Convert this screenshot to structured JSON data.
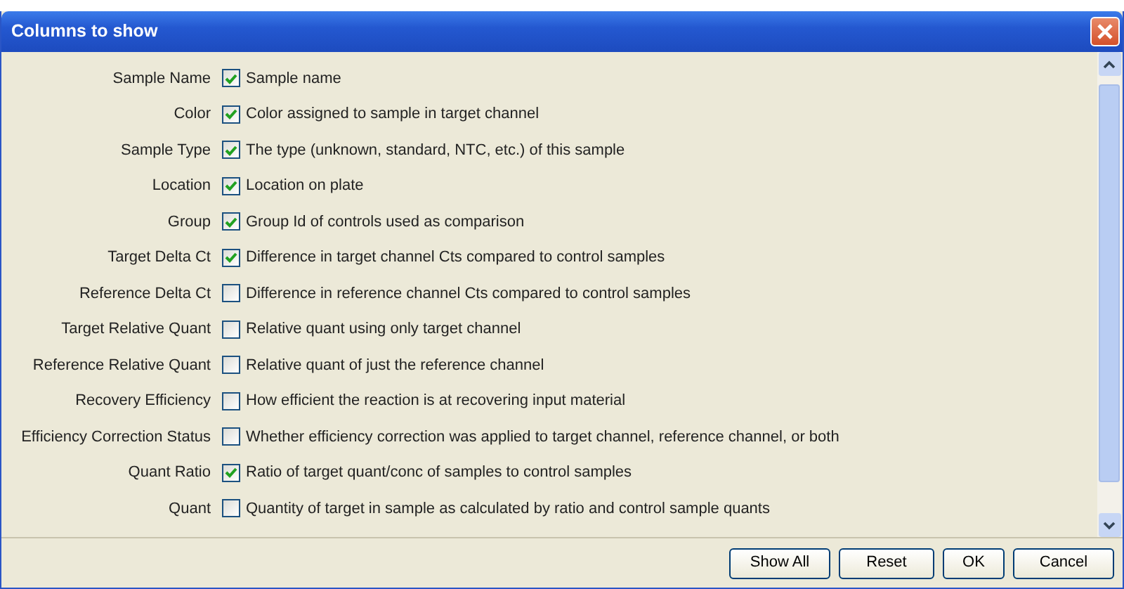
{
  "window": {
    "title": "Columns to show"
  },
  "columns": [
    {
      "name": "Sample Name",
      "description": "Sample name",
      "checked": true
    },
    {
      "name": "Color",
      "description": "Color assigned to sample in target channel",
      "checked": true
    },
    {
      "name": "Sample Type",
      "description": "The type (unknown, standard, NTC, etc.) of this sample",
      "checked": true
    },
    {
      "name": "Location",
      "description": "Location on plate",
      "checked": true
    },
    {
      "name": "Group",
      "description": "Group Id of controls used as comparison",
      "checked": true
    },
    {
      "name": "Target Delta Ct",
      "description": "Difference in target channel Cts compared to control samples",
      "checked": true
    },
    {
      "name": "Reference Delta Ct",
      "description": "Difference in reference channel Cts compared to control samples",
      "checked": false
    },
    {
      "name": "Target Relative Quant",
      "description": "Relative quant using only target channel",
      "checked": false
    },
    {
      "name": "Reference Relative Quant",
      "description": "Relative quant of just the reference channel",
      "checked": false
    },
    {
      "name": "Recovery Efficiency",
      "description": "How efficient the reaction is at recovering input material",
      "checked": false
    },
    {
      "name": "Efficiency Correction Status",
      "description": "Whether efficiency correction was applied to target channel, reference channel, or both",
      "checked": false
    },
    {
      "name": "Quant Ratio",
      "description": "Ratio of target quant/conc of samples to control samples",
      "checked": true
    },
    {
      "name": "Quant",
      "description": "Quantity of target in sample as calculated by ratio and control sample quants",
      "checked": false
    }
  ],
  "buttons": [
    "Show All",
    "Reset",
    "OK",
    "Cancel"
  ]
}
